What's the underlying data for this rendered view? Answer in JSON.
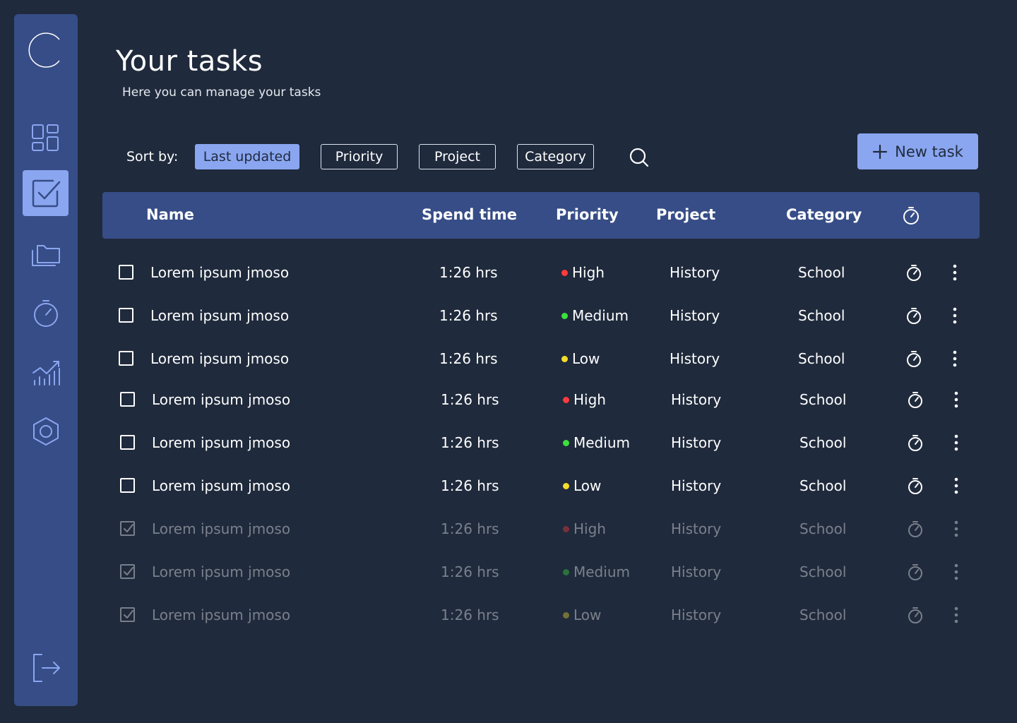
{
  "colors": {
    "background": "#1f2a3c",
    "sidebar": "#374d87",
    "accent": "#8aa6f0",
    "priority_high": "#ff3b3b",
    "priority_medium": "#3ce13c",
    "priority_low": "#f5dc2a"
  },
  "sidebar": {
    "items": [
      {
        "icon": "logo-icon"
      },
      {
        "icon": "dashboard-icon"
      },
      {
        "icon": "tasks-icon",
        "active": true
      },
      {
        "icon": "folder-icon"
      },
      {
        "icon": "timer-icon"
      },
      {
        "icon": "chart-icon"
      },
      {
        "icon": "settings-icon"
      },
      {
        "icon": "logout-icon"
      }
    ]
  },
  "header": {
    "title": "Your tasks",
    "subtitle": "Here you can manage your tasks"
  },
  "sort": {
    "label": "Sort by:",
    "options": [
      "Last updated",
      "Priority",
      "Project",
      "Category"
    ],
    "selected": "Last updated"
  },
  "new_task_label": "New task",
  "table": {
    "columns": {
      "name": "Name",
      "spend_time": "Spend time",
      "priority": "Priority",
      "project": "Project",
      "category": "Category"
    },
    "rows": [
      {
        "name": "Lorem ipsum jmoso",
        "spend_time": "1:26 hrs",
        "priority": "High",
        "project": "History",
        "category": "School",
        "done": false
      },
      {
        "name": "Lorem ipsum jmoso",
        "spend_time": "1:26 hrs",
        "priority": "Medium",
        "project": "History",
        "category": "School",
        "done": false
      },
      {
        "name": "Lorem ipsum jmoso",
        "spend_time": "1:26 hrs",
        "priority": "Low",
        "project": "History",
        "category": "School",
        "done": false
      },
      {
        "name": "Lorem ipsum jmoso",
        "spend_time": "1:26 hrs",
        "priority": "High",
        "project": "History",
        "category": "School",
        "done": false
      },
      {
        "name": "Lorem ipsum jmoso",
        "spend_time": "1:26 hrs",
        "priority": "Medium",
        "project": "History",
        "category": "School",
        "done": false
      },
      {
        "name": "Lorem ipsum jmoso",
        "spend_time": "1:26 hrs",
        "priority": "Low",
        "project": "History",
        "category": "School",
        "done": false
      },
      {
        "name": "Lorem ipsum jmoso",
        "spend_time": "1:26 hrs",
        "priority": "High",
        "project": "History",
        "category": "School",
        "done": true
      },
      {
        "name": "Lorem ipsum jmoso",
        "spend_time": "1:26 hrs",
        "priority": "Medium",
        "project": "History",
        "category": "School",
        "done": true
      },
      {
        "name": "Lorem ipsum jmoso",
        "spend_time": "1:26 hrs",
        "priority": "Low",
        "project": "History",
        "category": "School",
        "done": true
      }
    ]
  }
}
